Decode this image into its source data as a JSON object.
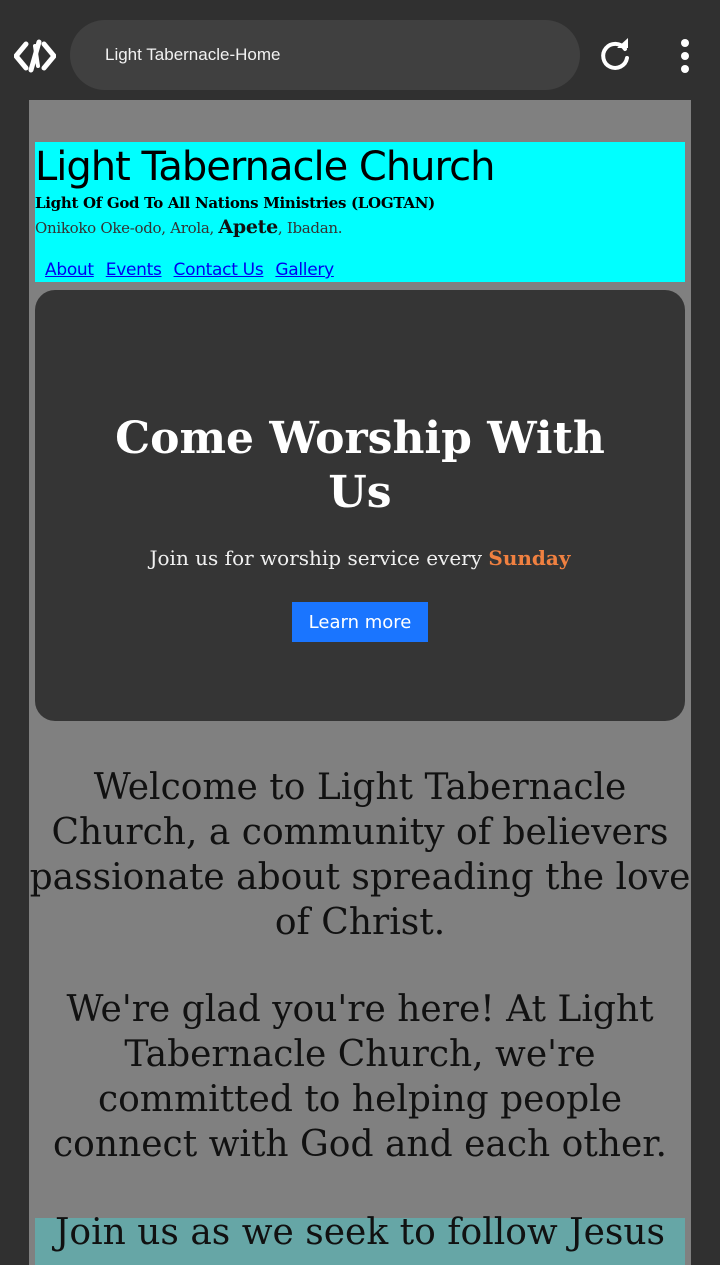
{
  "browser": {
    "url_text": "Light Tabernacle-Home",
    "icons": [
      "code-icon",
      "reload-icon",
      "more-vert-icon"
    ]
  },
  "header": {
    "church_name": "Light Tabernacle Church",
    "ministry": "Light Of God To All Nations Ministries (LOGTAN)",
    "address_part1": "Onikoko Oke-odo, Arola, ",
    "address_highlight": "Apete",
    "address_part2": ", Ibadan.",
    "nav": [
      "About",
      "Events",
      "Contact Us",
      "Gallery"
    ],
    "bg_color": "#00ffff"
  },
  "hero": {
    "title": "Come Worship With Us",
    "subtitle_prefix": "Join us for worship service every ",
    "subtitle_day": "Sunday",
    "button_label": "Learn more",
    "accent_color": "#f08040",
    "button_color": "#1a75ff"
  },
  "content": {
    "welcome": "Welcome to Light Tabernacle Church, a community of believers passionate about spreading the love of Christ.",
    "glad": "We're glad you're here! At Light Tabernacle Church, we're committed to helping people connect with God and each other.",
    "join": "Join us as we seek to follow Jesus"
  }
}
